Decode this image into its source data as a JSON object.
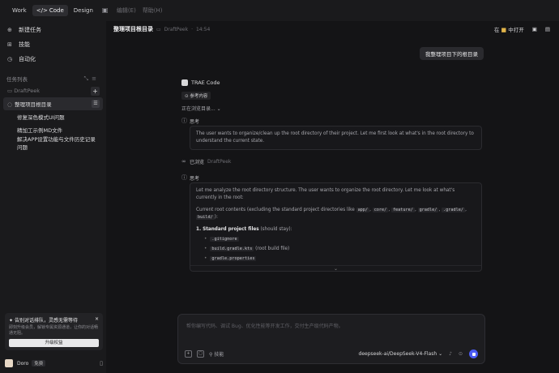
{
  "topbar": {
    "modes": [
      "Work",
      "Code",
      "Design"
    ],
    "active_mode": "Code",
    "code_glyph": "</>",
    "menu_edit": "编辑(E)",
    "menu_help": "帮助(H)"
  },
  "sidebar": {
    "items": [
      {
        "icon": "new-task-icon",
        "label": "新建任务"
      },
      {
        "icon": "skills-icon",
        "label": "技能"
      },
      {
        "icon": "automation-icon",
        "label": "自动化"
      }
    ],
    "task_list_label": "任务列表",
    "project": "DraftPeek",
    "tasks": [
      {
        "label": "整理项目根目录",
        "active": true
      },
      {
        "label": "修复深色模式UI问题"
      },
      {
        "label": "精加工示例MD文件"
      },
      {
        "label": "解决APP设置功能与文件历史记录问题"
      }
    ],
    "promo": {
      "title": "告别对话排队，灵感无需等待",
      "desc": "即刻升级会员，解锁专属资源通道，让你的对话畅通无阻。",
      "button": "升级权益"
    },
    "user": {
      "name": "Doro",
      "plan": "免费"
    }
  },
  "main": {
    "title": "整理项目根目录",
    "project": "DraftPeek",
    "time": "14:54",
    "open_in_label": "在",
    "open_in_target": "中打开",
    "user_message": "我整理项目下的根目录",
    "assistant_name": "TRAE Code",
    "ref_chip": "参考内容",
    "browsing": "正在浏览目录...",
    "thinking_label": "思考",
    "thinking_1": "The user wants to organize/clean up the root directory of their project. Let me first look at what's in the root directory to understand the current state.",
    "viewed_label": "已浏览",
    "viewed_target": "DraftPeek",
    "thinking_2_label": "思考",
    "analysis_intro": "Let me analyze the root directory structure. The user wants to organize the root directory. Let me look at what's currently in the root:",
    "current_root_prefix": "Current root contents (excluding the standard project directories like",
    "std_dirs": [
      "app/",
      "core/",
      "feature/",
      "gradle/",
      ".gradle/",
      "build/"
    ],
    "current_root_suffix": "):",
    "section_1_title": "1. Standard project files",
    "section_1_note": "(should stay):",
    "files": [
      {
        "name": ".gitignore",
        "note": ""
      },
      {
        "name": "build.gradle.kts",
        "note": "(root build file)"
      },
      {
        "name": "gradle.properties",
        "note": ""
      }
    ]
  },
  "composer": {
    "placeholder": "帮你编写代码、调试 Bug、优化性能等开发工作，交付生产级代码产物。",
    "skills": "技能",
    "model": "deepseek-ai/DeepSeek-V4-Flash"
  }
}
